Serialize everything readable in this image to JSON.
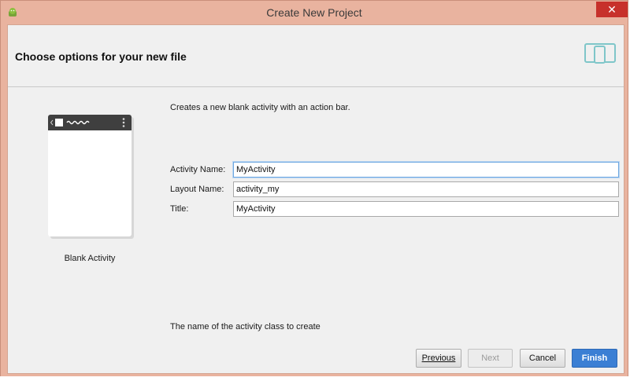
{
  "window": {
    "title": "Create New Project",
    "close_glyph": "✕"
  },
  "header": {
    "heading": "Choose options for your new file",
    "icon": "devices-icon"
  },
  "template": {
    "caption": "Blank Activity",
    "description": "Creates a new blank activity with an action bar."
  },
  "fields": {
    "activity_name": {
      "label": "Activity Name:",
      "value": "MyActivity"
    },
    "layout_name": {
      "label": "Layout Name:",
      "value": "activity_my"
    },
    "title": {
      "label": "Title:",
      "value": "MyActivity"
    }
  },
  "hint": "The name of the activity class to create",
  "buttons": {
    "previous": "Previous",
    "next": "Next",
    "cancel": "Cancel",
    "finish": "Finish"
  }
}
